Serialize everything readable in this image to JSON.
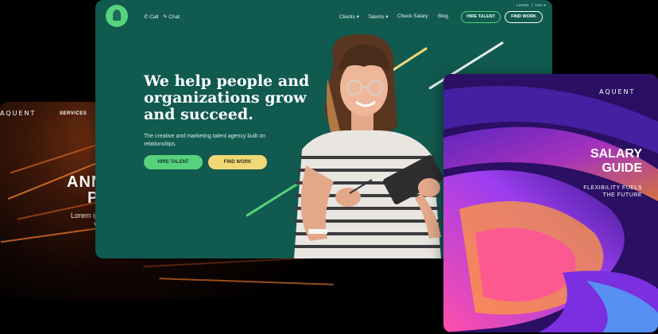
{
  "left_card": {
    "logo": "AQUENT",
    "nav_item": "SERVICES",
    "headline_line1": "ANN",
    "headline_line2": "PO",
    "body_line1": "Lorem ips",
    "body_line2": "vulpu"
  },
  "main_card": {
    "nav": {
      "call": "Call",
      "chat": "Chat",
      "clients": "Clients",
      "talents": "Talents",
      "check_salary": "Check Salary",
      "blog": "Blog",
      "hire_talent": "HIRE TALENT",
      "find_work": "FIND WORK",
      "login": "LOGIN",
      "region": "USA"
    },
    "hero": {
      "title": "We help people and organizations grow and succeed.",
      "subtitle": "The creative and marketing talent agency built on relationships.",
      "hire_button": "HIRE TALENT",
      "find_button": "FIND WORK"
    }
  },
  "right_card": {
    "logo": "AQUENT",
    "title_line1": "SALARY",
    "title_line2": "GUIDE",
    "sub_line1": "FLEXIBILITY FUELS",
    "sub_line2": "THE FUTURE"
  },
  "colors": {
    "main_bg": "#115a50",
    "accent_green": "#58d17d",
    "accent_yellow": "#f1d877"
  }
}
